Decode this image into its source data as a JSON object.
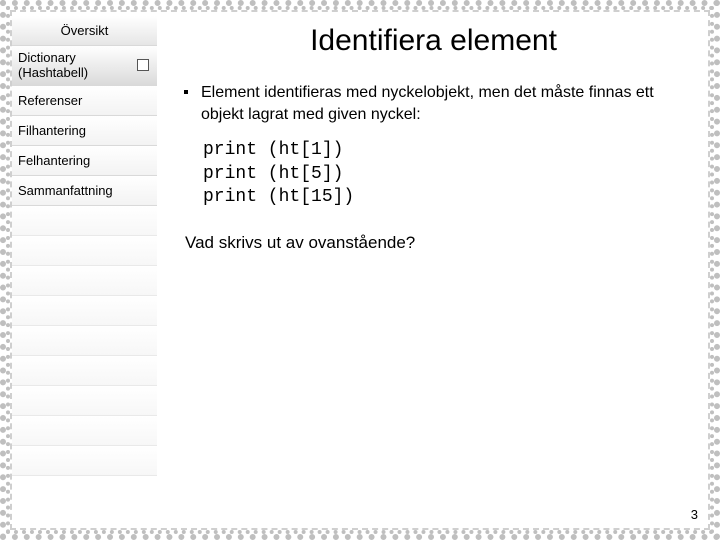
{
  "sidebar": {
    "header": "Översikt",
    "items": [
      {
        "label": "Dictionary\n(Hashtabell)",
        "selected": true
      },
      {
        "label": "Referenser"
      },
      {
        "label": "Filhantering"
      },
      {
        "label": "Felhantering"
      },
      {
        "label": "Sammanfattning"
      }
    ]
  },
  "main": {
    "title": "Identifiera element",
    "bullet_text": "Element identifieras med nyckelobjekt, men det måste finnas ett objekt lagrat med given nyckel:",
    "code_lines": [
      "print (ht[1])",
      "print (ht[5])",
      "print (ht[15])"
    ],
    "question": "Vad skrivs ut av ovanstående?"
  },
  "page_number": "3"
}
